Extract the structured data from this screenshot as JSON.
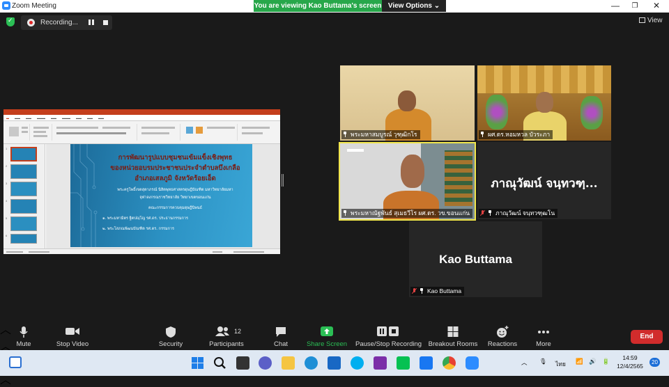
{
  "window": {
    "title": "Zoom Meeting",
    "minimize": "—",
    "maximize": "❐",
    "close": "✕"
  },
  "banner": {
    "viewing": "You are viewing Kao Buttama's screen",
    "view_options": "View Options ⌄"
  },
  "recording": {
    "label": "Recording..."
  },
  "view_button": {
    "label": "View"
  },
  "slide": {
    "title_lines": [
      "การพัฒนารูปแบบชุมชนเข้มแข็งเชิงพุทธ",
      "ของหน่วยอบรมประชาชนประจำตำบลบึงเกลือ",
      "อำเภอเสลภูมิ จังหวัดร้อยเอ็ด"
    ],
    "author_lines": [
      "พระครูโพธิ์เขตสุตาภรณ์ นิสิตพุทธศาสตรดุษฎีบัณฑิต มหาวิทยาลัยมหา",
      "จุฬาลงกรณราชวิทยาลัย วิทยาเขตขอนแก่น"
    ],
    "committee_heading": "คณะกรรมการควบคุมดุษฎีนิพนธ์",
    "committee": [
      "๑. พระมหามิตร ฐิตปญฺโญ รศ.ดร. ประธานกรรมการ",
      "๒. พระโสภณพัฒนบัณฑิต รศ.ดร. กรรมการ"
    ],
    "thumb_numbers": [
      "1",
      "2",
      "3",
      "4",
      "5",
      "6"
    ]
  },
  "participants": [
    {
      "name": "พระมหาสมบูรณ์ วุฑฺฒิกโร",
      "muted": false
    },
    {
      "name": "ผศ.ดร.หอมหวล บัวระภา",
      "muted": false
    },
    {
      "name": "พระมหาณัฐพันธ์ สุเมธวีโร ผศ.ดร. วข.ขอนแก่น",
      "muted": false,
      "active_speaker": true
    },
    {
      "name": "ภาณุวัฒน์ จนฺทวฑฺฒโน",
      "display_name": "ภาณุวัฒน์ จนฺทวฑฺ...",
      "muted": true
    },
    {
      "name": "Kao Buttama",
      "display_name": "Kao Buttama",
      "muted": true
    }
  ],
  "toolbar": {
    "mute": "Mute",
    "stop_video": "Stop Video",
    "security": "Security",
    "participants": "Participants",
    "participants_count": "12",
    "chat": "Chat",
    "share_screen": "Share Screen",
    "pause_stop_recording": "Pause/Stop Recording",
    "breakout_rooms": "Breakout Rooms",
    "reactions": "Reactions",
    "more": "More",
    "end": "End"
  },
  "taskbar": {
    "language": "ไทย",
    "time": "14:59",
    "date": "12/4/2565",
    "notifications": "20"
  },
  "colors": {
    "banner_green": "#27a74a",
    "end_red": "#d12c2c",
    "share_green": "#2bbf55",
    "active_speaker": "#f1e64c",
    "muted_red": "#e04343"
  }
}
